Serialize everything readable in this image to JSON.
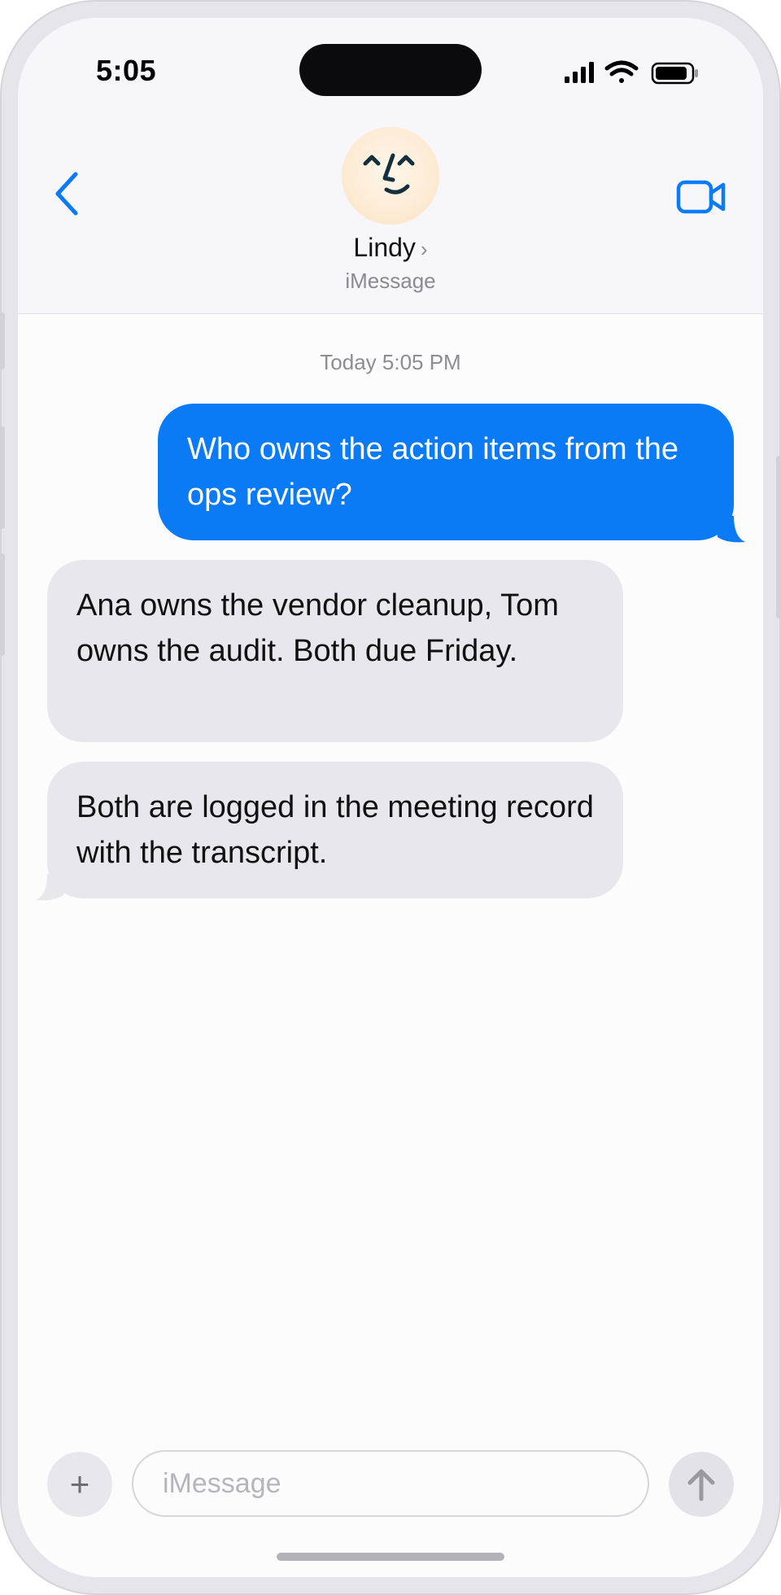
{
  "status_bar": {
    "time": "5:05"
  },
  "header": {
    "contact_name": "Lindy",
    "chevron": "›",
    "service": "iMessage",
    "back_icon": "chevron-left-icon",
    "video_icon": "video-camera-icon"
  },
  "conversation": {
    "timestamp": "Today 5:05 PM",
    "messages": [
      {
        "direction": "outgoing",
        "text": "Who owns the action items from the ops review?"
      },
      {
        "direction": "incoming",
        "text": "Ana owns the vendor cleanup, Tom owns the audit. Both due Friday."
      },
      {
        "direction": "incoming",
        "text": "Both are logged in the meeting record with the transcript."
      }
    ]
  },
  "composer": {
    "plus_label": "+",
    "placeholder": "iMessage",
    "send_icon": "arrow-up-icon"
  },
  "colors": {
    "accent": "#0a7bf5",
    "incoming_bubble": "#e8e7eb"
  }
}
